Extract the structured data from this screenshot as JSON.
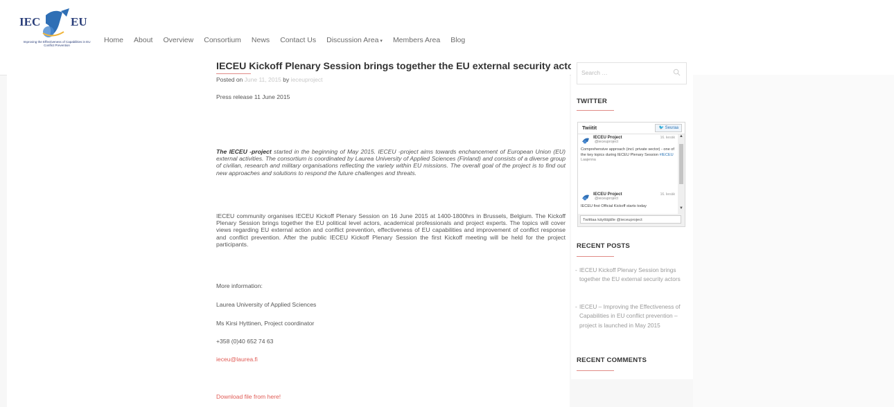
{
  "header": {
    "logo": {
      "left": "IEC",
      "right": "EU",
      "tagline": "Improving the Effectiveness of Capabilities in EU Conflict Prevention"
    },
    "nav": [
      {
        "label": "Home"
      },
      {
        "label": "About"
      },
      {
        "label": "Overview"
      },
      {
        "label": "Consortium"
      },
      {
        "label": "News"
      },
      {
        "label": "Contact Us"
      },
      {
        "label": "Discussion Area",
        "dropdown": true
      },
      {
        "label": "Members Area"
      },
      {
        "label": "Blog"
      }
    ]
  },
  "post": {
    "title": "IECEU Kickoff Plenary Session brings together the EU external security actors",
    "meta": {
      "posted_on": "Posted on",
      "date": "June 11, 2015",
      "by": "by",
      "author": "ieceuproject"
    },
    "press_release": "Press release 11 June 2015",
    "intro_bold": "The IECEU -project",
    "intro_rest": " started in the beginning of May 2015. IECEU -project aims towards enchancement of European Union (EU) external activities. The consortium is coordinated by Laurea University of Applied Sciences (Finland) and consists of a diverse group of civilian, research and military organisations reflecting the variety within EU missions. The overall goal of the project is to find out new approaches and solutions to respond the future challenges and threats.",
    "body": "IECEU community organises IECEU Kickoff Plenary Session on 16 June 2015 at 1400-1800hrs in Brussels, Belgium. The Kickoff Plenary Session brings together the EU political level actors, academical professionals and project experts. The topics will cover views regarding EU external action and conflict prevention, effectiveness of EU capabilities and improvement of conflict response and conflict prevention. After the public IECEU Kickoff Plenary Session the first Kickoff meeting will be held for the project participants.",
    "more_info": "More information:",
    "org": "Laurea University of Applied Sciences",
    "contact": "Ms Kirsi Hyttinen, Project coordinator",
    "phone": "+358 (0)40 652 74 63",
    "email": "ieceu@laurea.fi",
    "download": "Download file from here!"
  },
  "sidebar": {
    "search_placeholder": "Search …",
    "twitter_title": "TWITTER",
    "twitter_widget": {
      "header": "Twiitit",
      "follow": "Seuraa",
      "tweets": [
        {
          "name": "IECEU Project",
          "handle": "@ieceuproject",
          "date": "16. kesäk",
          "text": "Comprehensive approach (incl. private sector) - one of the key topics during IECEU Plenary Session ",
          "hashtag": "#IECEU",
          "more": "Laajenna"
        },
        {
          "name": "IECEU Project",
          "handle": "@ieceuproject",
          "date": "16. kesäk",
          "text": "IECEU first Official Kickoff starts today"
        }
      ],
      "reply_placeholder": "Twiittaa käyttäjälle @ieceuproject"
    },
    "recent_posts_title": "RECENT POSTS",
    "recent_posts": [
      "IECEU Kickoff Plenary Session brings together the EU external security actors",
      "IECEU – Improving the Effectiveness of Capabilities in EU conflict prevention –project is launched in May 2015"
    ],
    "recent_comments_title": "RECENT COMMENTS"
  }
}
